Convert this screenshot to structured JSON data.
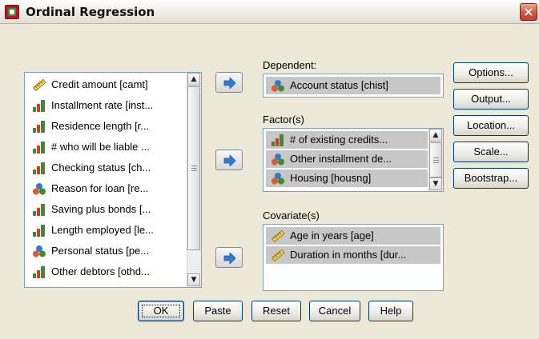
{
  "window": {
    "title": "Ordinal Regression",
    "close_glyph": "×"
  },
  "variables": [
    {
      "label": "Credit amount [camt]",
      "icon": "ruler-icon"
    },
    {
      "label": "Installment rate [inst...",
      "icon": "ordinal-bars-icon"
    },
    {
      "label": "Residence length [r...",
      "icon": "ordinal-bars-icon"
    },
    {
      "label": "# who will be liable ...",
      "icon": "ordinal-bars-icon"
    },
    {
      "label": "Checking status [ch...",
      "icon": "ordinal-bars-icon"
    },
    {
      "label": "Reason for loan [re...",
      "icon": "nominal-circles-icon"
    },
    {
      "label": "Saving plus bonds [...",
      "icon": "ordinal-bars-icon"
    },
    {
      "label": "Length employed [le...",
      "icon": "ordinal-bars-icon"
    },
    {
      "label": "Personal status [pe...",
      "icon": "nominal-circles-icon"
    },
    {
      "label": "Other debtors [othd...",
      "icon": "ordinal-bars-icon"
    }
  ],
  "dependent": {
    "label": "Dependent:",
    "value": "Account status [chist]",
    "icon": "nominal-circles-icon"
  },
  "factors": {
    "label": "Factor(s)",
    "items": [
      {
        "label": "# of existing credits...",
        "icon": "ordinal-bars-icon"
      },
      {
        "label": "Other installment de...",
        "icon": "nominal-circles-icon"
      },
      {
        "label": "Housing [housng]",
        "icon": "nominal-circles-icon"
      }
    ]
  },
  "covariates": {
    "label": "Covariate(s)",
    "items": [
      {
        "label": "Age in years [age]",
        "icon": "ruler-icon"
      },
      {
        "label": "Duration in months [dur...",
        "icon": "ruler-icon"
      }
    ]
  },
  "side_buttons": [
    "Options...",
    "Output...",
    "Location...",
    "Scale...",
    "Bootstrap..."
  ],
  "bottom_buttons": [
    "OK",
    "Paste",
    "Reset",
    "Cancel",
    "Help"
  ],
  "colors": {
    "accent_blue": "#2f7bd0",
    "selection_gray": "#c7c7c7",
    "ordinal_red": "#d83a2a",
    "ordinal_green": "#3c8d2f"
  }
}
